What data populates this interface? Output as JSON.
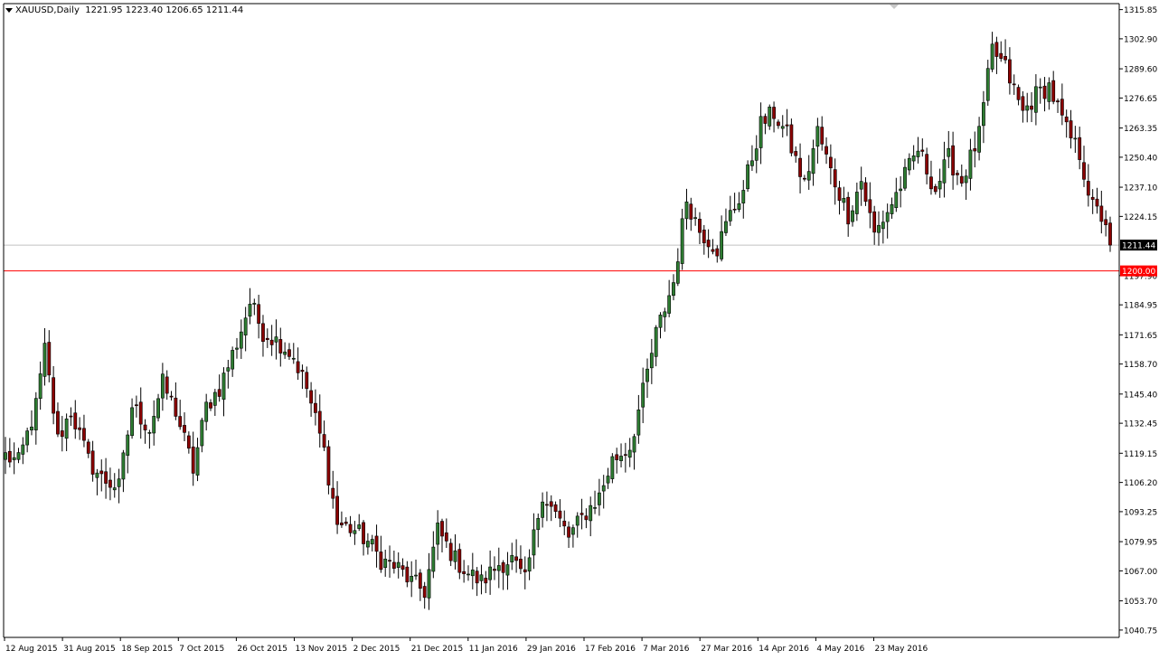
{
  "header": {
    "symbol": "XAUUSD",
    "timeframe": "Daily",
    "ohlc": "1221.95 1223.40 1206.65 1211.44"
  },
  "colors": {
    "background": "#ffffff",
    "bull": "#2e7d32",
    "bear": "#8b0000",
    "wick": "#000000",
    "price_line": "#c0c0c0",
    "level_line": "#ff0000",
    "level_label_bg": "#ff0000",
    "price_label_bg": "#000000"
  },
  "chart_data": {
    "type": "candlestick",
    "title": "",
    "xlabel": "",
    "ylabel": "",
    "ylim": [
      1037.5,
      1318.5
    ],
    "y_ticks": [
      "1315.85",
      "1302.90",
      "1289.60",
      "1276.65",
      "1263.35",
      "1250.40",
      "1237.10",
      "1224.15",
      "1197.90",
      "1184.95",
      "1171.65",
      "1158.70",
      "1145.40",
      "1132.45",
      "1119.15",
      "1106.20",
      "1093.25",
      "1079.95",
      "1067.00",
      "1053.70",
      "1040.75"
    ],
    "x_labels": [
      "12 Aug 2015",
      "31 Aug 2015",
      "18 Sep 2015",
      "7 Oct 2015",
      "26 Oct 2015",
      "13 Nov 2015",
      "2 Dec 2015",
      "21 Dec 2015",
      "11 Jan 2016",
      "29 Jan 2016",
      "17 Feb 2016",
      "7 Mar 2016",
      "27 Mar 2016",
      "14 Apr 2016",
      "4 May 2016",
      "23 May 2016"
    ],
    "current_price": "1211.44",
    "horizontal_level": "1200.00",
    "anchors": [
      [
        0,
        1118
      ],
      [
        3,
        1115
      ],
      [
        7,
        1140
      ],
      [
        9,
        1165
      ],
      [
        12,
        1125
      ],
      [
        15,
        1138
      ],
      [
        19,
        1116
      ],
      [
        22,
        1108
      ],
      [
        26,
        1104
      ],
      [
        29,
        1140
      ],
      [
        33,
        1130
      ],
      [
        36,
        1150
      ],
      [
        39,
        1138
      ],
      [
        43,
        1112
      ],
      [
        46,
        1140
      ],
      [
        49,
        1148
      ],
      [
        53,
        1168
      ],
      [
        56,
        1186
      ],
      [
        59,
        1173
      ],
      [
        63,
        1168
      ],
      [
        66,
        1162
      ],
      [
        69,
        1148
      ],
      [
        73,
        1120
      ],
      [
        76,
        1088
      ],
      [
        80,
        1085
      ],
      [
        83,
        1080
      ],
      [
        86,
        1072
      ],
      [
        90,
        1068
      ],
      [
        93,
        1062
      ],
      [
        96,
        1058
      ],
      [
        99,
        1085
      ],
      [
        103,
        1072
      ],
      [
        106,
        1066
      ],
      [
        109,
        1062
      ],
      [
        113,
        1070
      ],
      [
        116,
        1072
      ],
      [
        119,
        1062
      ],
      [
        123,
        1102
      ],
      [
        126,
        1092
      ],
      [
        129,
        1082
      ],
      [
        133,
        1093
      ],
      [
        136,
        1100
      ],
      [
        139,
        1116
      ],
      [
        143,
        1122
      ],
      [
        146,
        1146
      ],
      [
        149,
        1172
      ],
      [
        153,
        1195
      ],
      [
        156,
        1232
      ],
      [
        159,
        1218
      ],
      [
        163,
        1210
      ],
      [
        166,
        1225
      ],
      [
        169,
        1236
      ],
      [
        173,
        1265
      ],
      [
        176,
        1270
      ],
      [
        179,
        1260
      ],
      [
        183,
        1238
      ],
      [
        186,
        1262
      ],
      [
        189,
        1244
      ],
      [
        193,
        1225
      ],
      [
        196,
        1240
      ],
      [
        199,
        1216
      ],
      [
        203,
        1230
      ],
      [
        206,
        1242
      ],
      [
        209,
        1254
      ],
      [
        213,
        1236
      ],
      [
        216,
        1250
      ],
      [
        219,
        1240
      ],
      [
        223,
        1260
      ],
      [
        226,
        1298
      ],
      [
        229,
        1290
      ],
      [
        233,
        1270
      ],
      [
        236,
        1278
      ],
      [
        239,
        1282
      ],
      [
        243,
        1262
      ],
      [
        246,
        1252
      ],
      [
        249,
        1228
      ],
      [
        252,
        1222
      ],
      [
        253,
        1211.44
      ]
    ]
  }
}
